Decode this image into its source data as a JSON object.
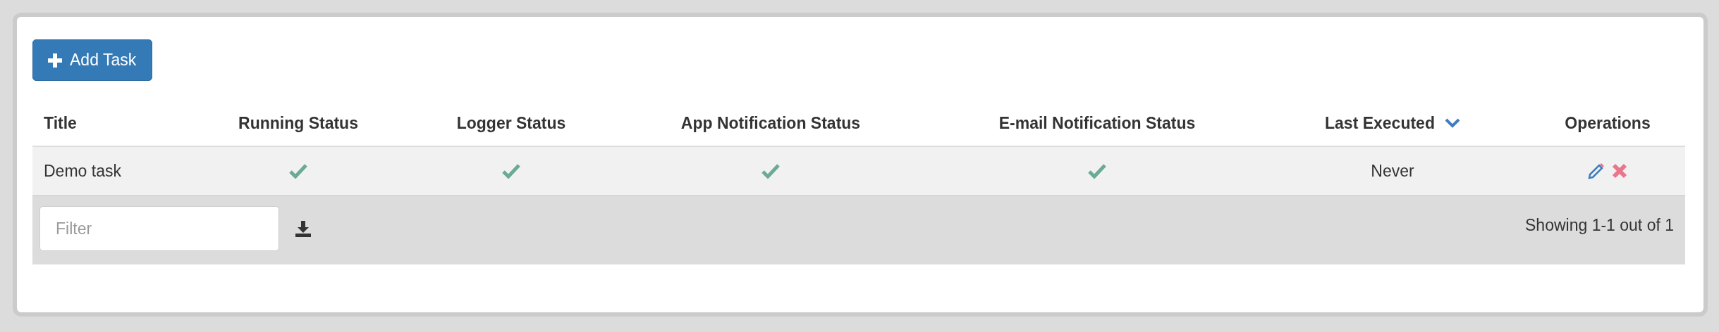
{
  "add_button": {
    "label": "Add Task"
  },
  "table": {
    "columns": [
      {
        "label": "Title",
        "sorted": false
      },
      {
        "label": "Running Status",
        "sorted": false
      },
      {
        "label": "Logger Status",
        "sorted": false
      },
      {
        "label": "App Notification Status",
        "sorted": false
      },
      {
        "label": "E-mail Notification Status",
        "sorted": false
      },
      {
        "label": "Last Executed",
        "sorted": true
      },
      {
        "label": "Operations",
        "sorted": false
      }
    ],
    "rows": [
      {
        "title": "Demo task",
        "running": true,
        "logger": true,
        "app_notification": true,
        "email_notification": true,
        "last_executed": "Never"
      }
    ]
  },
  "footer": {
    "filter": {
      "placeholder": "Filter"
    },
    "summary": "Showing 1-1 out of 1"
  }
}
